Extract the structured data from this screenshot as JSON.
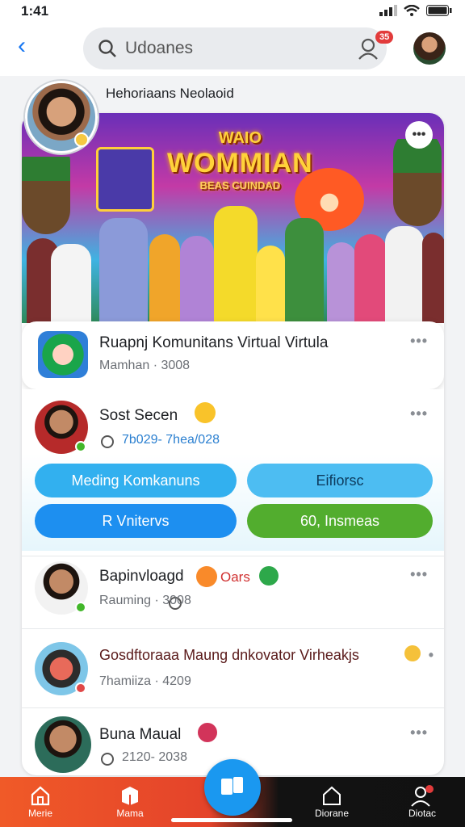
{
  "status": {
    "time": "1:41"
  },
  "header": {
    "search_text": "Udoanes",
    "notif_count": "35"
  },
  "group": {
    "name": "Hehoriaans Neolaoid"
  },
  "banner": {
    "line1": "WAIO",
    "line2": "WOMMIAN",
    "line3": "BEAS CUINDAD"
  },
  "rows": [
    {
      "title": "Ruapnj Komunitans Virtual Virtula",
      "sub": "Mamhan ·  3008"
    },
    {
      "title": "Sost Secen",
      "sub": "7b029- 7hea/028"
    },
    {
      "title": "Bapinvloagd",
      "tag": "Oars",
      "sub": "Rauming ·  3008"
    },
    {
      "title": "Gosdftoraaa Maung dnkovator Virheakjs",
      "sub": "7hamiiza ·  4209"
    },
    {
      "title": "Buna Maual",
      "sub": "2120-  2038"
    }
  ],
  "buttons": {
    "b1": "Meding Komkanuns",
    "b2": "Eifiorsc",
    "b3": "R Vnitervs",
    "b4": "60, Insmeas"
  },
  "nav": {
    "home": "Merie",
    "market": "Mama",
    "n4": "Diorane",
    "n5": "Diotac"
  },
  "colors": {
    "accent": "#1877f2",
    "blue_btn": "#1d8ff0",
    "green_btn": "#52ad2e",
    "nav_red": "#f05a28"
  }
}
